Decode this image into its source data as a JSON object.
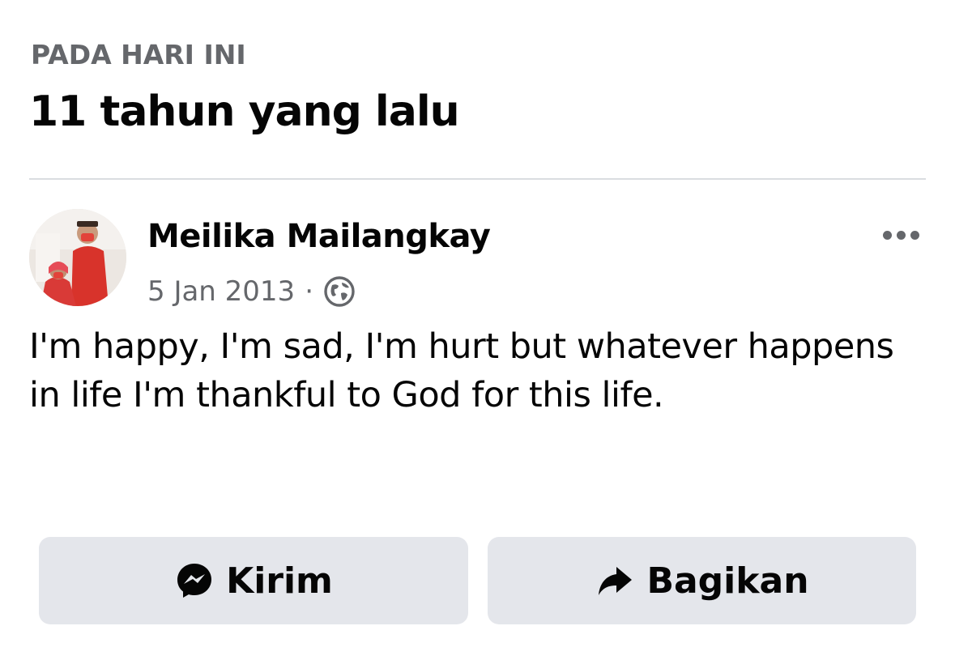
{
  "memory": {
    "label": "PADA HARI INI",
    "title": "11 tahun yang lalu"
  },
  "post": {
    "author": "Meilika Mailangkay",
    "date": "5 Jan 2013",
    "separator": "·",
    "privacy_icon": "globe-icon",
    "text": "I'm happy, I'm sad, I'm hurt but whatever happens in life I'm thankful to God for this life.",
    "more_icon": "more-options-icon"
  },
  "actions": {
    "send": {
      "label": "Kirim",
      "icon": "messenger-icon"
    },
    "share": {
      "label": "Bagikan",
      "icon": "share-arrow-icon"
    }
  },
  "colors": {
    "secondary_text": "#65676b",
    "primary_text": "#050505",
    "button_bg": "#e4e6eb",
    "divider": "#dadde1"
  }
}
